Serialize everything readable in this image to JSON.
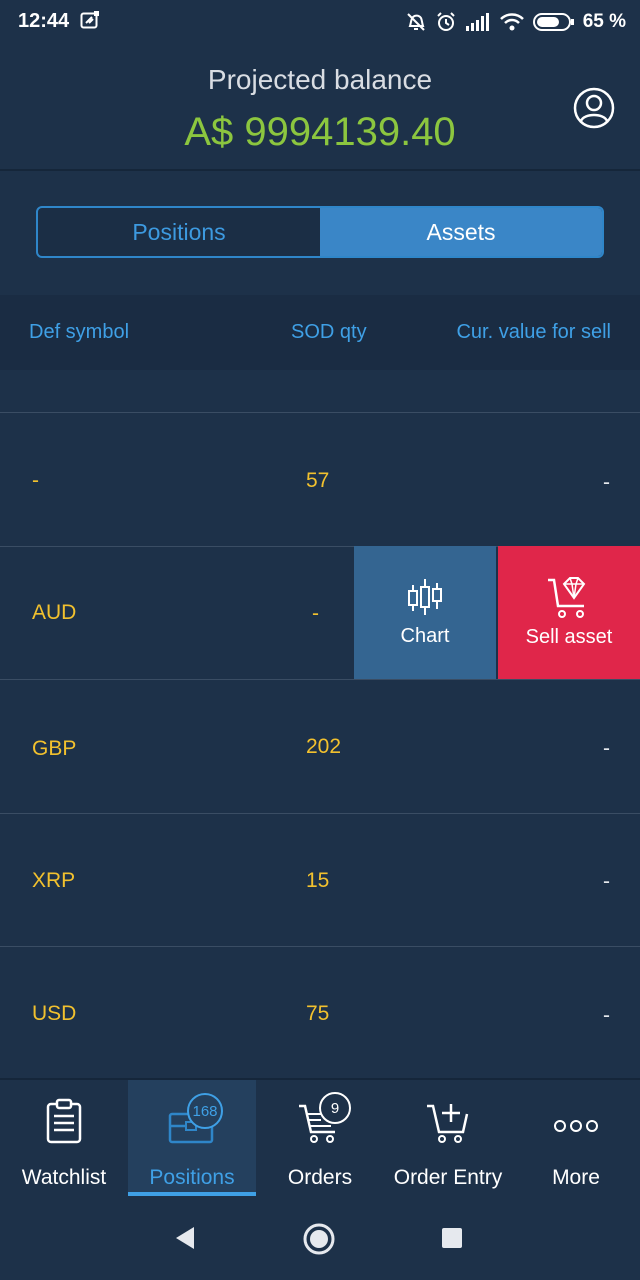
{
  "status_bar": {
    "time": "12:44",
    "battery": "65 %"
  },
  "header": {
    "title": "Projected balance",
    "balance": "A$ 9994139.40"
  },
  "segment": {
    "tabs": [
      "Positions",
      "Assets"
    ],
    "active": "Assets"
  },
  "table": {
    "columns": [
      "Def symbol",
      "SOD qty",
      "Cur. value for sell"
    ],
    "rows": [
      {
        "symbol": "-",
        "qty": "57",
        "value": "-"
      },
      {
        "symbol": "AUD",
        "qty": "-",
        "value": ""
      },
      {
        "symbol": "GBP",
        "qty": "202",
        "value": "-"
      },
      {
        "symbol": "XRP",
        "qty": "15",
        "value": "-"
      },
      {
        "symbol": "USD",
        "qty": "75",
        "value": "-"
      }
    ],
    "swipe_actions": {
      "chart_label": "Chart",
      "sell_label": "Sell asset"
    }
  },
  "bottom_nav": {
    "items": [
      {
        "label": "Watchlist",
        "icon": "clipboard-icon"
      },
      {
        "label": "Positions",
        "icon": "briefcase-icon",
        "badge": "168"
      },
      {
        "label": "Orders",
        "icon": "cart-icon",
        "badge": "9"
      },
      {
        "label": "Order Entry",
        "icon": "cart-plus-icon"
      },
      {
        "label": "More",
        "icon": "more-dots-icon"
      }
    ],
    "active": "Positions"
  },
  "colors": {
    "background": "#1d3149",
    "accent": "#3fa0e6",
    "balance": "#8cc63f",
    "value_text": "#f2c12e",
    "sell": "#e0264a",
    "chart_action": "#346591"
  }
}
